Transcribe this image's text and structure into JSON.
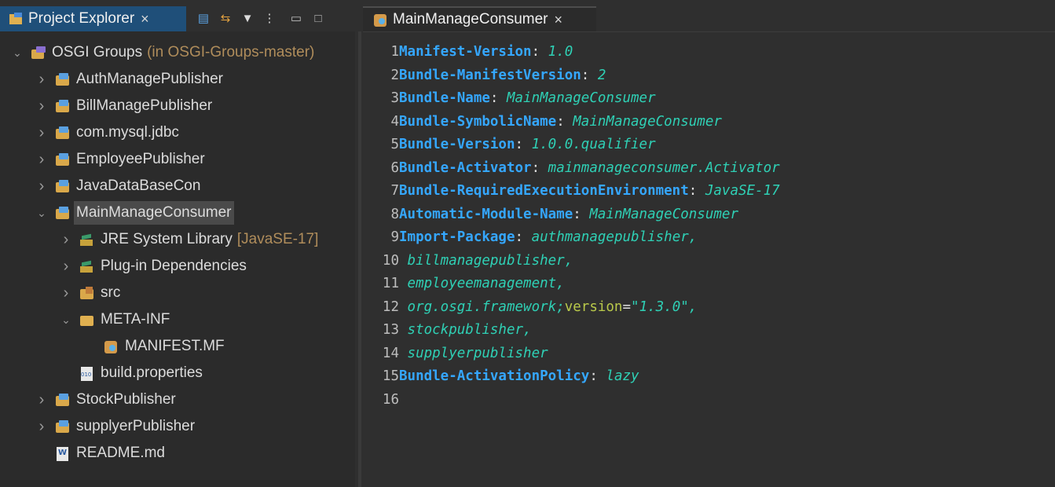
{
  "explorer": {
    "tab_label": "Project Explorer",
    "close_glyph": "×",
    "toolbar": [
      {
        "name": "collapse-all-icon",
        "glyph": "▤"
      },
      {
        "name": "link-with-editor-icon",
        "glyph": "⇆"
      },
      {
        "name": "filter-icon",
        "glyph": "▼"
      },
      {
        "name": "view-menu-icon",
        "glyph": "⋮"
      },
      {
        "name": "minimize-icon",
        "glyph": "▭"
      },
      {
        "name": "maximize-icon",
        "glyph": "□"
      }
    ],
    "tree": [
      {
        "label": "OSGI Groups",
        "decoration": "(in OSGI-Groups-master)",
        "expanded": true,
        "indent": 0,
        "icon": "working-set-icon"
      },
      {
        "label": "AuthManagePublisher",
        "expanded": false,
        "indent": 1,
        "icon": "plugin-project-icon"
      },
      {
        "label": "BillManagePublisher",
        "expanded": false,
        "indent": 1,
        "icon": "plugin-project-icon"
      },
      {
        "label": "com.mysql.jdbc",
        "expanded": false,
        "indent": 1,
        "icon": "plugin-project-icon"
      },
      {
        "label": "EmployeePublisher",
        "expanded": false,
        "indent": 1,
        "icon": "plugin-project-icon"
      },
      {
        "label": "JavaDataBaseCon",
        "expanded": false,
        "indent": 1,
        "icon": "plugin-project-icon"
      },
      {
        "label": "MainManageConsumer",
        "expanded": true,
        "indent": 1,
        "icon": "plugin-project-icon",
        "selected": true
      },
      {
        "label": "JRE System Library",
        "decoration": "[JavaSE-17]",
        "expanded": false,
        "indent": 2,
        "icon": "library-icon"
      },
      {
        "label": "Plug-in Dependencies",
        "expanded": false,
        "indent": 2,
        "icon": "library-icon"
      },
      {
        "label": "src",
        "expanded": false,
        "indent": 2,
        "icon": "source-folder-icon"
      },
      {
        "label": "META-INF",
        "expanded": true,
        "indent": 2,
        "icon": "folder-icon"
      },
      {
        "label": "MANIFEST.MF",
        "indent": 3,
        "icon": "manifest-icon"
      },
      {
        "label": "build.properties",
        "indent": 2,
        "icon": "properties-icon"
      },
      {
        "label": "StockPublisher",
        "expanded": false,
        "indent": 1,
        "icon": "plugin-project-icon"
      },
      {
        "label": "supplyerPublisher",
        "expanded": false,
        "indent": 1,
        "icon": "plugin-project-icon"
      },
      {
        "label": "README.md",
        "indent": 1,
        "icon": "readme-icon"
      }
    ]
  },
  "editor": {
    "tab_label": "MainManageConsumer",
    "close_glyph": "×",
    "lines": [
      {
        "num": "1",
        "key": "Manifest-Version",
        "sep": ": ",
        "value": "1.0"
      },
      {
        "num": "2",
        "key": "Bundle-ManifestVersion",
        "sep": ": ",
        "value": "2"
      },
      {
        "num": "3",
        "key": "Bundle-Name",
        "sep": ": ",
        "value": "MainManageConsumer"
      },
      {
        "num": "4",
        "key": "Bundle-SymbolicName",
        "sep": ": ",
        "value": "MainManageConsumer"
      },
      {
        "num": "5",
        "key": "Bundle-Version",
        "sep": ": ",
        "value": "1.0.0.qualifier"
      },
      {
        "num": "6",
        "key": "Bundle-Activator",
        "sep": ": ",
        "value": "mainmanageconsumer.Activator"
      },
      {
        "num": "7",
        "key": "Bundle-RequiredExecutionEnvironment",
        "sep": ": ",
        "value": "JavaSE-17"
      },
      {
        "num": "8",
        "key": "Automatic-Module-Name",
        "sep": ": ",
        "value": "MainManageConsumer"
      },
      {
        "num": "9",
        "key": "Import-Package",
        "sep": ": ",
        "value": "authmanagepublisher,"
      },
      {
        "num": "10",
        "value": " billmanagepublisher,"
      },
      {
        "num": "11",
        "value": " employeemanagement,"
      },
      {
        "num": "12",
        "value": " org.osgi.framework;",
        "attr": "version",
        "eq": "=",
        "str": "\"1.3.0\","
      },
      {
        "num": "13",
        "value": " stockpublisher,"
      },
      {
        "num": "14",
        "value": " supplyerpublisher"
      },
      {
        "num": "15",
        "key": "Bundle-ActivationPolicy",
        "sep": ": ",
        "value": "lazy"
      },
      {
        "num": "16"
      }
    ]
  }
}
